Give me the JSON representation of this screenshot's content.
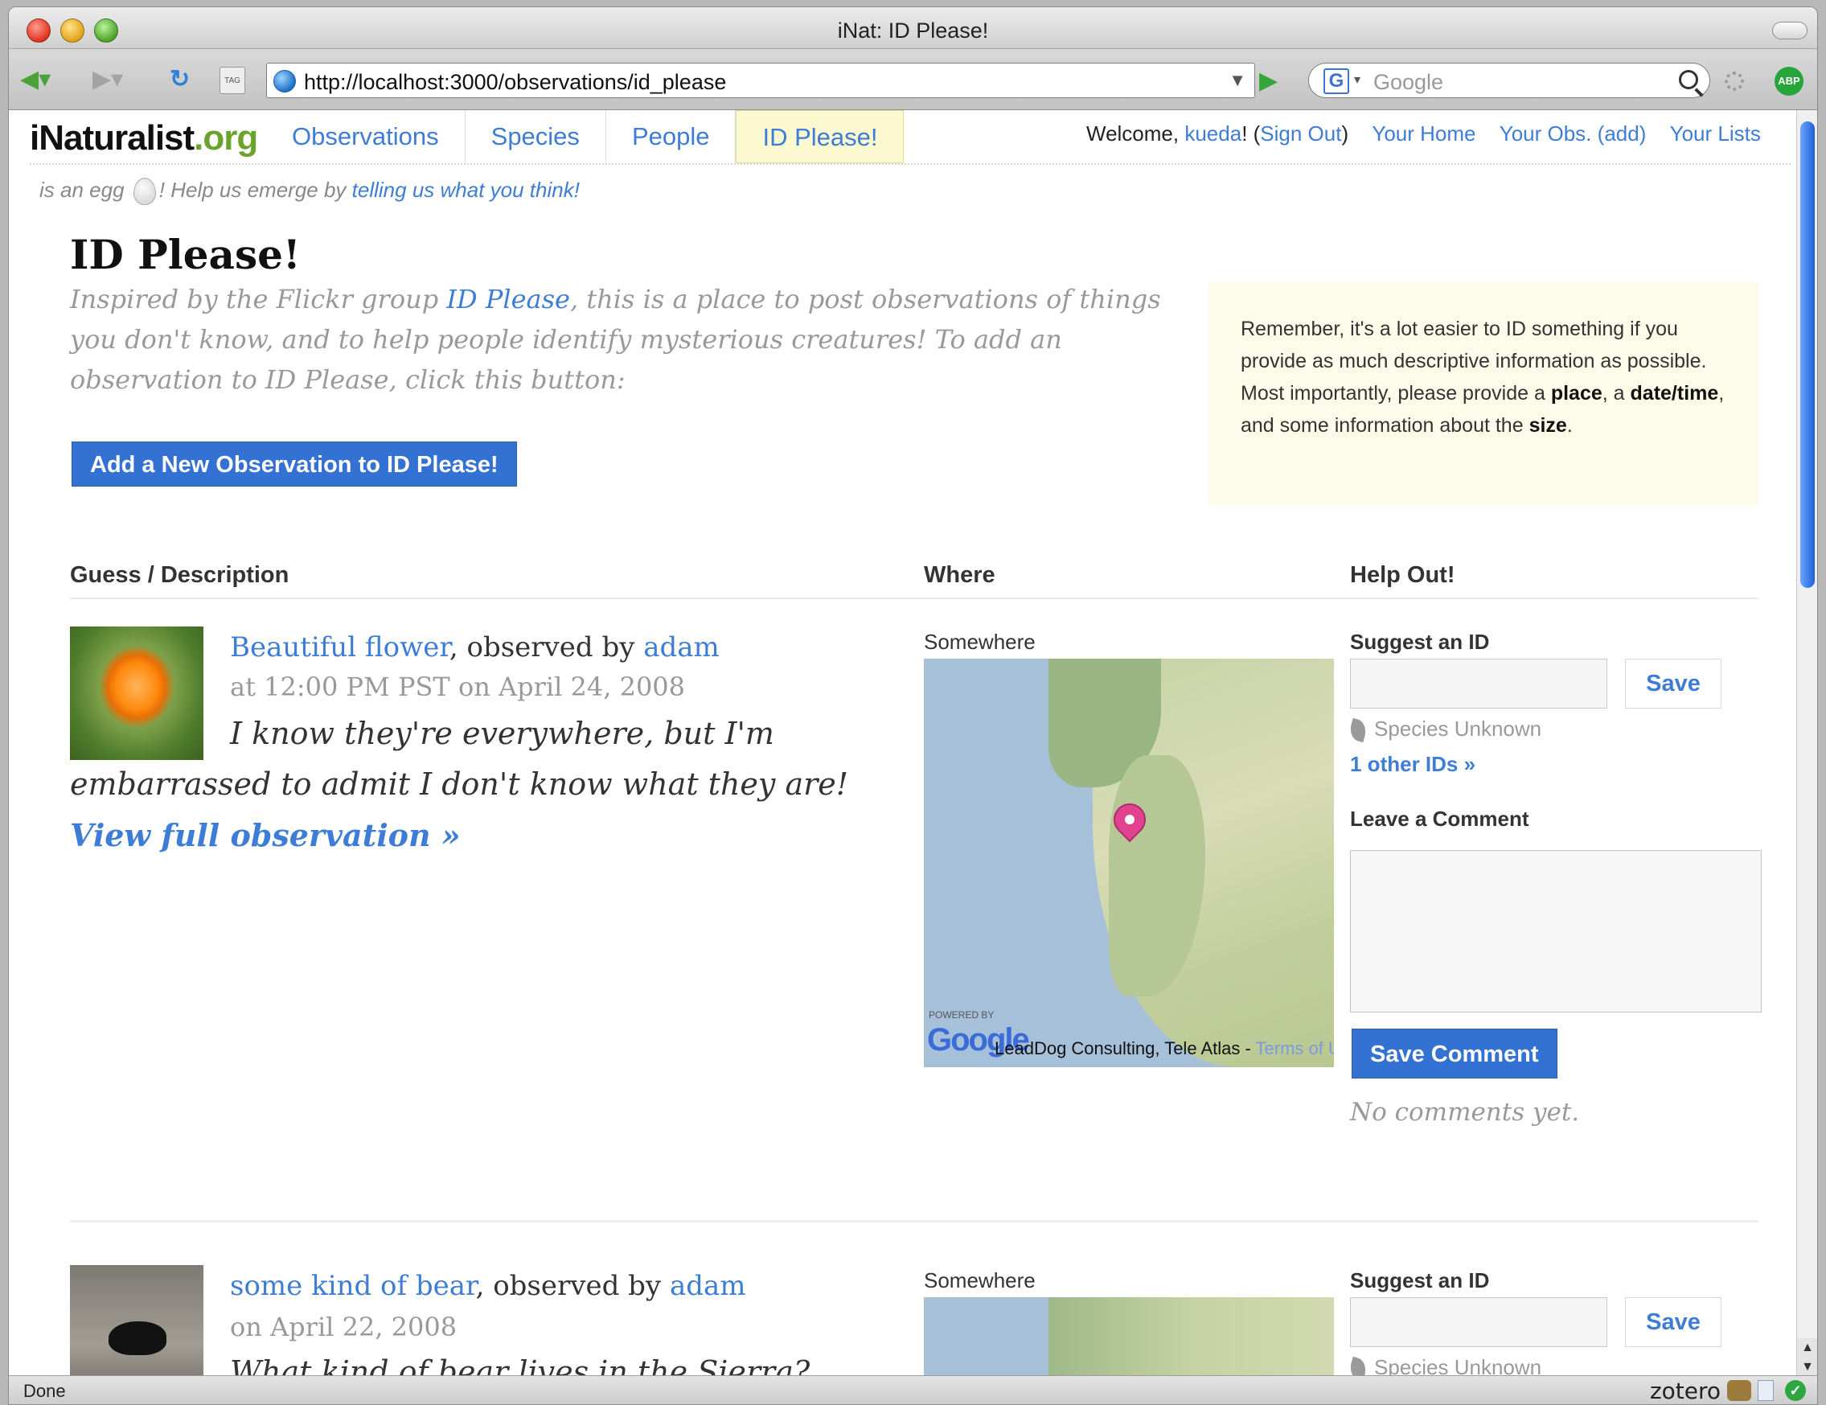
{
  "window": {
    "title": "iNat: ID Please!"
  },
  "browser": {
    "url": "http://localhost:3000/observations/id_please",
    "search_placeholder": "Google",
    "search_engine_letter": "G",
    "tag_label": "TAG",
    "abp_label": "ABP",
    "status": "Done",
    "zotero_label": "zotero"
  },
  "site": {
    "logo_main": "iNaturalist",
    "logo_tld": ".org",
    "nav": [
      {
        "label": "Observations"
      },
      {
        "label": "Species"
      },
      {
        "label": "People"
      },
      {
        "label": "ID Please!",
        "active": true
      }
    ],
    "user": {
      "welcome": "Welcome,",
      "username": "kueda",
      "bang": "! (",
      "sign_out": "Sign Out",
      "close_paren": ")",
      "your_home": "Your Home",
      "your_obs": "Your Obs.",
      "add_open": "(",
      "add": "add",
      "add_close": ")",
      "your_lists": "Your Lists"
    },
    "egg": {
      "prefix": "is an egg",
      "middle": "! Help us emerge by",
      "link": "telling us what you think!"
    }
  },
  "page": {
    "title": "ID Please!",
    "intro_before": "Inspired by the Flickr group ",
    "intro_link": "ID Please",
    "intro_after": ", this is a place to post observations of things you don't know, and to help people identify mysterious creatures! To add an observation to ID Please, click this button:",
    "add_button": "Add a New Observation to ID Please!",
    "tip": {
      "t1": "Remember, it's a lot easier to ID something if you provide as much descriptive information as possible. Most importantly, please provide a ",
      "place": "place",
      "t2": ", a ",
      "datetime": "date/time",
      "t3": ", and some information about the ",
      "size": "size",
      "t4": "."
    },
    "columns": {
      "guess": "Guess / Description",
      "where": "Where",
      "help": "Help Out!"
    }
  },
  "observations": [
    {
      "title": "Beautiful flower",
      "observed_by": ", observed by ",
      "user": "adam",
      "date": "at 12:00 PM PST on April 24, 2008",
      "description": "I know they're everywhere, but I'm embarrassed to admit I don't know what they are!",
      "view_full": "View full observation »",
      "where": "Somewhere",
      "suggest_label": "Suggest an ID",
      "save": "Save",
      "species_unknown": "Species Unknown",
      "other_ids": "1 other IDs »",
      "leave_comment": "Leave a Comment",
      "save_comment": "Save Comment",
      "no_comments": "No comments yet.",
      "map": {
        "powered_by": "POWERED BY",
        "google": "Google",
        "credit": "LeadDog Consulting, Tele Atlas - ",
        "terms": "Terms of Use"
      }
    },
    {
      "title": "some kind of bear",
      "observed_by": ", observed by ",
      "user": "adam",
      "date": "on April 22, 2008",
      "description": "What kind of bear lives in the Sierra?",
      "where": "Somewhere",
      "suggest_label": "Suggest an ID",
      "save": "Save",
      "species_unknown": "Species Unknown"
    }
  ],
  "colors": {
    "link": "#3d7dd6",
    "button": "#3371d2",
    "active_tab": "#fcf8cf",
    "tipbox": "#fdfbe9",
    "logo_green": "#6aa42a",
    "map_pin": "#e0428f"
  }
}
